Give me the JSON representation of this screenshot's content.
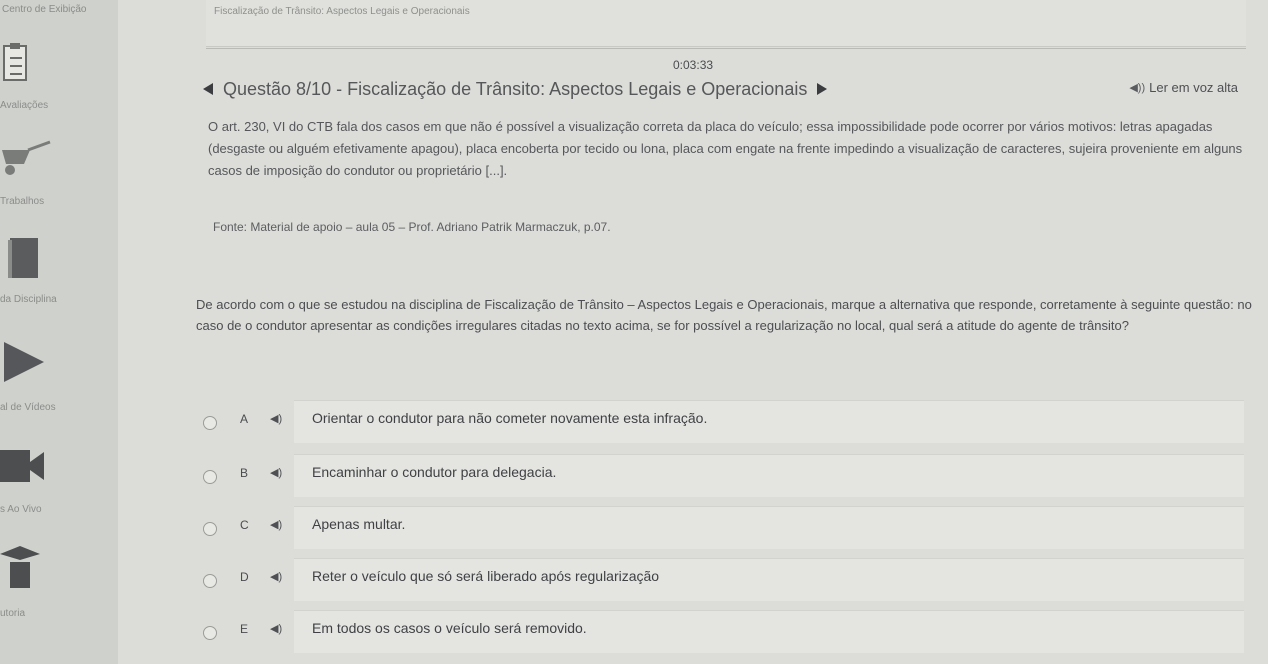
{
  "sidebar": {
    "top_label": "Centro de Exibição",
    "items": [
      {
        "label": "Avaliações",
        "icon": "checklist-icon"
      },
      {
        "label": "Trabalhos",
        "icon": "wheelbarrow-icon"
      },
      {
        "label": "da Disciplina",
        "icon": "book-icon"
      },
      {
        "label": "al de Vídeos",
        "icon": "play-icon"
      },
      {
        "label": "s Ao Vivo",
        "icon": "video-camera-icon"
      },
      {
        "label": "utoria",
        "icon": "graduate-icon"
      }
    ]
  },
  "breadcrumb": "Fiscalização de Trânsito: Aspectos Legais e Operacionais",
  "timer": "0:03:33",
  "question": {
    "title": "Questão 8/10 - Fiscalização de Trânsito: Aspectos Legais e Operacionais",
    "read_aloud": "Ler em voz alta",
    "intro": "O art. 230, VI do CTB fala dos casos em que não é possível a visualização correta da placa do veículo; essa impossibilidade pode ocorrer por vários motivos: letras apagadas (desgaste ou alguém efetivamente apagou), placa encoberta por tecido ou lona, placa com engate na frente impedindo a visualização de caracteres, sujeira proveniente em alguns casos de imposição do condutor ou proprietário [...].",
    "source": "Fonte: Material de apoio – aula 05 – Prof. Adriano Patrik Marmaczuk, p.07.",
    "prompt": "De acordo com o que se estudou na disciplina de Fiscalização de Trânsito – Aspectos Legais e Operacionais, marque a alternativa que responde, corretamente à seguinte questão: no caso de o condutor apresentar as condições irregulares citadas no texto acima, se for possível a regularização no local, qual será a atitude do agente de trânsito?",
    "options": [
      {
        "letter": "A",
        "text": "Orientar o condutor para não cometer novamente esta infração."
      },
      {
        "letter": "B",
        "text": "Encaminhar o condutor para delegacia."
      },
      {
        "letter": "C",
        "text": "Apenas multar."
      },
      {
        "letter": "D",
        "text": "Reter o veículo que só será liberado após regularização"
      },
      {
        "letter": "E",
        "text": "Em todos os casos o veículo será removido."
      }
    ]
  },
  "colors": {
    "background": "#dcddd9",
    "sidebar": "#cfd1cd",
    "text": "#3f4144"
  }
}
